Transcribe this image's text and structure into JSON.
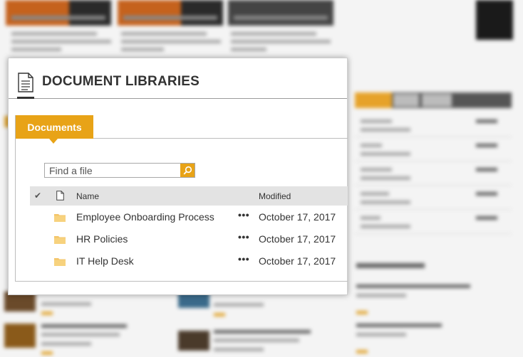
{
  "dialog": {
    "title": "DOCUMENT LIBRARIES",
    "tab_label": "Documents",
    "search": {
      "placeholder": "Find a file",
      "value": ""
    },
    "columns": {
      "name": "Name",
      "modified": "Modified"
    },
    "files": [
      {
        "name": "Employee Onboarding Process",
        "modified": "October 17, 2017"
      },
      {
        "name": "HR Policies",
        "modified": "October 17, 2017"
      },
      {
        "name": "IT Help Desk",
        "modified": "October 17, 2017"
      }
    ],
    "more_actions_glyph": "•••"
  },
  "colors": {
    "accent": "#e8a317",
    "header_bg": "#e3e3e3",
    "text": "#333333",
    "folder": "#f3c56a"
  },
  "icons": [
    "document-icon",
    "search-icon",
    "check-icon",
    "file-icon",
    "folder-icon",
    "more-actions-icon"
  ]
}
